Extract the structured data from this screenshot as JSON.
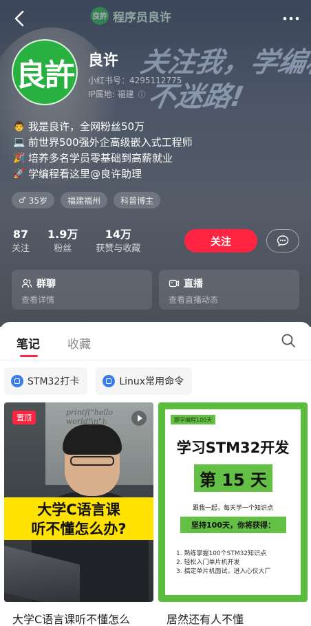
{
  "top_brand": {
    "logo_text": "良許",
    "name": "程序员良许"
  },
  "bg_slogan": {
    "line1": "关注我，学编程，",
    "line2": "不迷路!"
  },
  "profile": {
    "avatar_text": "良許",
    "nickname": "良许",
    "red_id": "小红书号：4295112775",
    "ip_label": "IP属地: 福建",
    "ip_icon": "ⓘ"
  },
  "bio": [
    {
      "icon": "person-laptop-emoji",
      "glyph": "👨",
      "text": "我是良许，全网粉丝50万"
    },
    {
      "icon": "laptop-emoji",
      "glyph": "💻",
      "text": "前世界500强外企高级嵌入式工程师"
    },
    {
      "icon": "party-emoji",
      "glyph": "🎉",
      "text": "培养多名学员零基础到高薪就业"
    },
    {
      "icon": "rocket-emoji",
      "glyph": "🚀",
      "text": "学编程看这里@良许助理"
    }
  ],
  "tags": [
    {
      "icon": "♂",
      "label": "35岁"
    },
    {
      "label": "福建福州"
    },
    {
      "label": "科普博主"
    }
  ],
  "stats": [
    {
      "num": "87",
      "label": "关注"
    },
    {
      "num": "1.9万",
      "label": "粉丝"
    },
    {
      "num": "14万",
      "label": "获赞与收藏"
    }
  ],
  "follow_label": "关注",
  "cards": [
    {
      "title": "群聊",
      "sub": "查看详情"
    },
    {
      "title": "直播",
      "sub": "查看直播动态"
    }
  ],
  "tabs": [
    {
      "label": "笔记"
    },
    {
      "label": "收藏"
    }
  ],
  "chips": [
    {
      "label": "STM32打卡"
    },
    {
      "label": "Linux常用命令"
    }
  ],
  "notes": [
    {
      "badge": "置顶",
      "board_text": "printf(\"hello world!\\n\");",
      "caption_line1": "大学C语言课",
      "caption_line2": "听不懂怎么办?",
      "title": "大学C语言课听不懂怎么"
    },
    {
      "series": "跟学编程100天",
      "headline": "学习STM32开发",
      "day": "第 15 天",
      "line1": "跟我一起，每天学一个知识点",
      "banner": "坚持100天，你将获得：",
      "list": [
        "1. 熟练掌握100个STM32知识点",
        "2. 轻松入门单片机开发",
        "3. 搞定单片机面试，进入心仪大厂"
      ],
      "title": "居然还有人不懂"
    }
  ],
  "colors": {
    "accent": "#ff2442",
    "brand_green": "#28b041",
    "header_bg": "#4b5566"
  }
}
